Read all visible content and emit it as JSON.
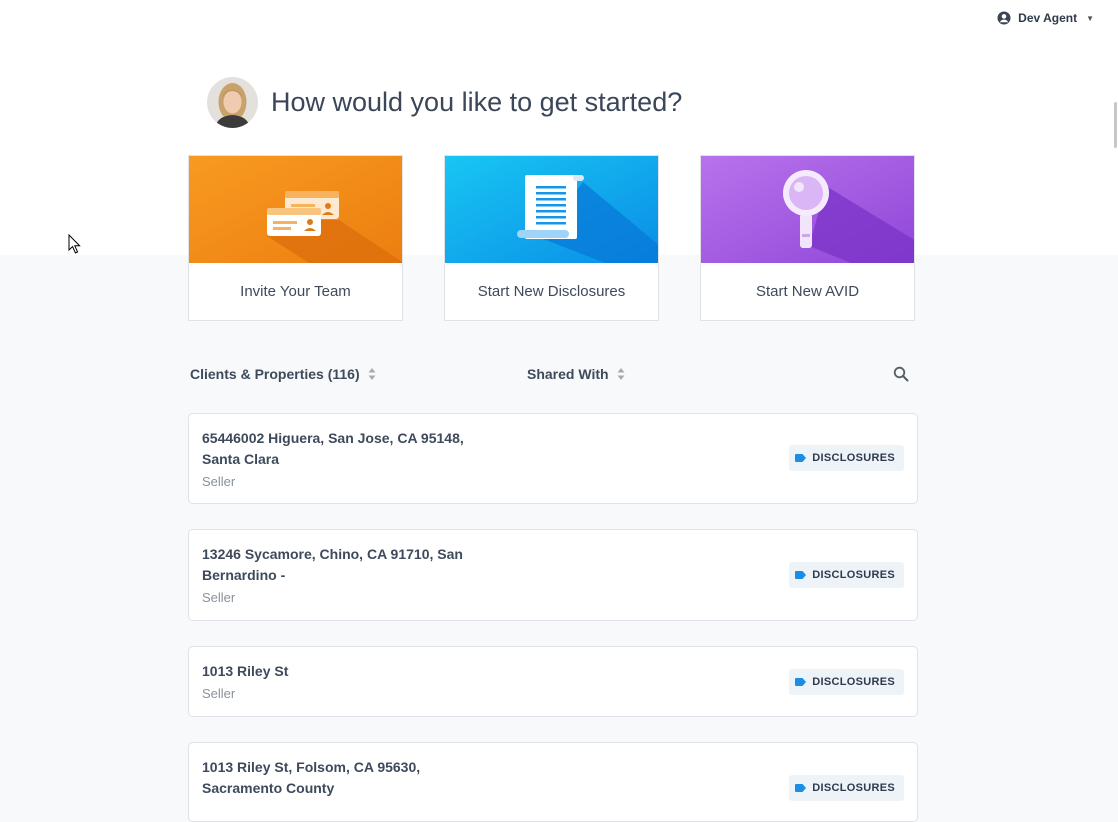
{
  "user_menu": {
    "name": "Dev Agent"
  },
  "header": {
    "title": "How would you like to get started?"
  },
  "cards": [
    {
      "label": "Invite Your Team",
      "color": "#f7931a"
    },
    {
      "label": "Start New Disclosures",
      "color": "#12b6f0"
    },
    {
      "label": "Start New AVID",
      "color": "#a35de0"
    }
  ],
  "list_header": {
    "clients_label": "Clients & Properties (116)",
    "shared_label": "Shared With"
  },
  "rows": [
    {
      "address": "65446002 Higuera, San Jose, CA 95148, Santa Clara",
      "role": "Seller",
      "badge": "DISCLOSURES"
    },
    {
      "address": "13246 Sycamore, Chino, CA 91710, San Bernardino -",
      "role": "Seller",
      "badge": "DISCLOSURES"
    },
    {
      "address": "1013 Riley St",
      "role": "Seller",
      "badge": "DISCLOSURES"
    },
    {
      "address": "1013 Riley St, Folsom, CA 95630, Sacramento County",
      "role": "",
      "badge": "DISCLOSURES"
    }
  ]
}
